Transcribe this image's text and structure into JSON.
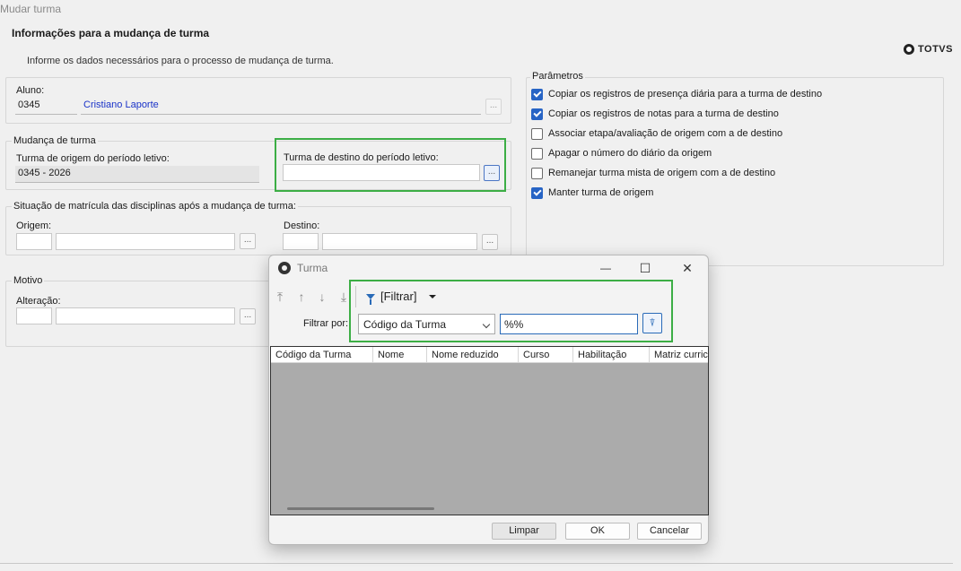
{
  "window": {
    "title": "Mudar turma"
  },
  "header": {
    "title": "Informações para a mudança de turma",
    "instructions": "Informe os dados necessários para o processo de mudança de turma.",
    "logo_text": "TOTVS"
  },
  "aluno": {
    "label": "Aluno:",
    "code": "0345",
    "name": "Cristiano Laporte",
    "lookup": "..."
  },
  "mudanca": {
    "label": "Mudança de turma",
    "origem_label": "Turma de origem do período letivo:",
    "origem_value": "0345 - 2026",
    "destino_label": "Turma de destino do período letivo:",
    "destino_value": "",
    "lookup": "..."
  },
  "situacao": {
    "label": "Situação de matrícula das disciplinas após a mudança de turma:",
    "origem_label": "Origem:",
    "destino_label": "Destino:",
    "lookup": "..."
  },
  "motivo": {
    "label": "Motivo",
    "alteracao_label": "Alteração:",
    "lookup": "..."
  },
  "parametros": {
    "label": "Parâmetros",
    "items": [
      {
        "label": "Copiar os registros de presença diária para a turma de destino",
        "checked": true
      },
      {
        "label": "Copiar os registros de notas para a turma de destino",
        "checked": true
      },
      {
        "label": "Associar etapa/avaliação de origem com a de destino",
        "checked": false
      },
      {
        "label": "Apagar o número do diário da origem",
        "checked": false
      },
      {
        "label": "Remanejar turma mista de origem com a de destino",
        "checked": false
      },
      {
        "label": "Manter turma de origem",
        "checked": true
      }
    ]
  },
  "dialog": {
    "title": "Turma",
    "controls": {
      "minimize": "—",
      "maximize": "☐",
      "close": "✕"
    },
    "toolbar": {
      "first": "⤒",
      "up": "↑",
      "down": "↓",
      "last": "⤓",
      "filter_label": "[Filtrar]"
    },
    "filter_by_label": "Filtrar por:",
    "filter_field": "Código da Turma",
    "filter_value": "%%",
    "columns": [
      "Código da Turma",
      "Nome",
      "Nome reduzido",
      "Curso",
      "Habilitação",
      "Matriz curricu"
    ],
    "buttons": {
      "limpar": "Limpar",
      "ok": "OK",
      "cancelar": "Cancelar"
    }
  },
  "colors": {
    "highlight": "#3cae45",
    "accent": "#2764c5",
    "link": "#1a33c8"
  }
}
